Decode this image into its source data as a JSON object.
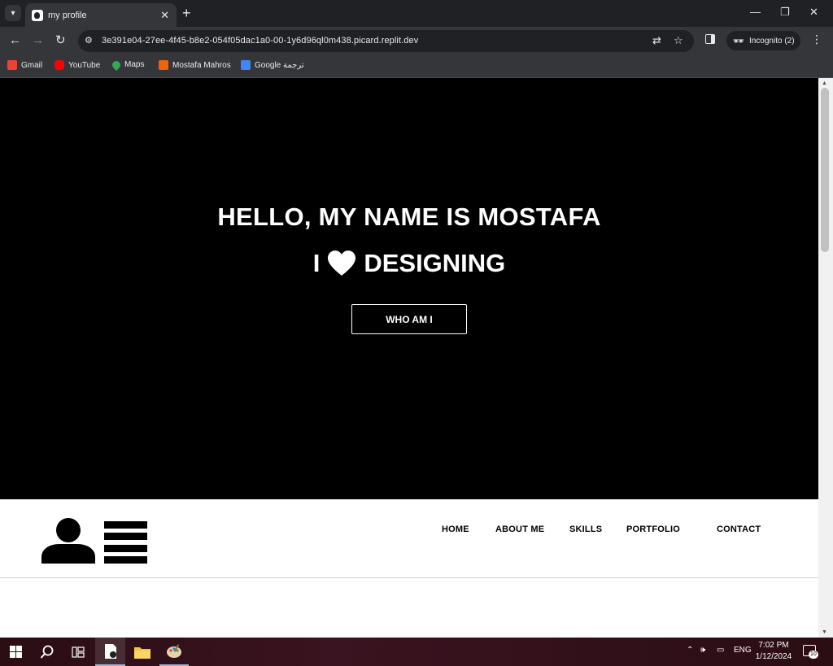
{
  "browser": {
    "tab": {
      "title": "my profile"
    },
    "address": {
      "url": "3e391e04-27ee-4f45-b8e2-054f05dac1a0-00-1y6d96ql0m438.picard.replit.dev"
    },
    "incognito": {
      "label": "Incognito (2)"
    },
    "bookmarks": [
      {
        "label": "Gmail",
        "icon": "gmail-icon",
        "color": "#ea4335"
      },
      {
        "label": "YouTube",
        "icon": "youtube-icon",
        "color": "#ff0000"
      },
      {
        "label": "Maps",
        "icon": "maps-icon",
        "color": "#34a853"
      },
      {
        "label": "Mostafa Mahros",
        "icon": "replit-icon",
        "color": "#f26207"
      },
      {
        "label": "Google ترجمة",
        "icon": "translate-icon",
        "color": "#4285f4"
      }
    ]
  },
  "hero": {
    "heading": "HELLO, MY NAME IS MOSTAFA",
    "tagline_prefix": "I",
    "tagline_suffix": "DESIGNING",
    "button_label": "WHO AM I"
  },
  "nav": {
    "items": [
      "HOME",
      "ABOUT ME",
      "SKILLS",
      "PORTFOLIO",
      "CONTACT"
    ]
  },
  "taskbar": {
    "language": "ENG",
    "time": "7:02 PM",
    "date": "1/12/2024",
    "notification_count": "10"
  }
}
